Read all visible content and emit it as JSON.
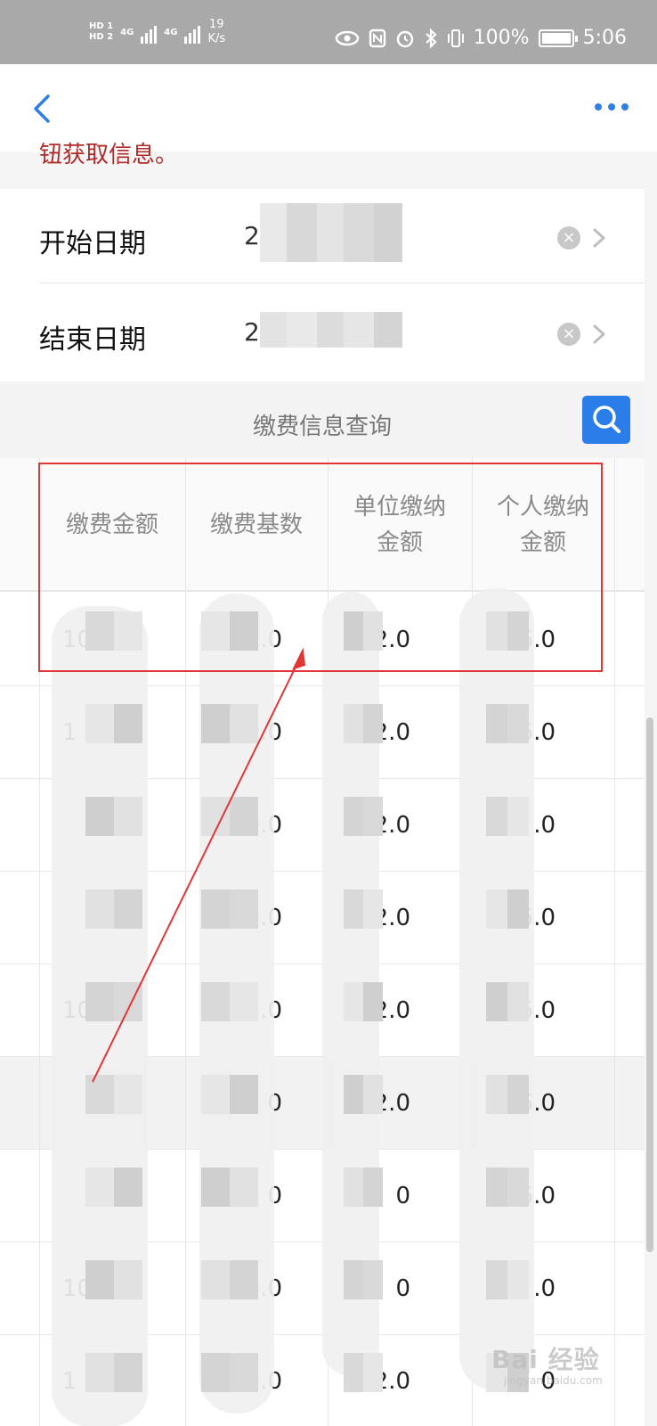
{
  "status_bar": {
    "hd1": "HD 1",
    "hd2": "HD 2",
    "net1": "4G",
    "net2": "4G",
    "speed_value": "19",
    "speed_unit": "K/s",
    "battery": "100%",
    "time": "5:06",
    "icons": [
      "eye-icon",
      "nfc-icon",
      "alarm-icon",
      "bluetooth-icon",
      "vibrate-icon",
      "battery-icon"
    ]
  },
  "nav": {
    "back_icon": "chevron-left-icon",
    "more_icon": "more-dots-icon",
    "accent": "#2f7ee6"
  },
  "hint": {
    "text": "钮获取信息。",
    "color": "#b02a2a"
  },
  "form": {
    "start_label": "开始日期",
    "start_value": "2",
    "end_label": "结束日期",
    "end_value": "2"
  },
  "query": {
    "title": "缴费信息查询",
    "search_icon": "search-icon",
    "button_color": "#2b7de9"
  },
  "table": {
    "headers": [
      "缴费金额",
      "缴费基数",
      "单位缴纳\n金额",
      "个人缴纳\n金额"
    ],
    "rows": [
      [
        "10",
        ".0",
        "72.0",
        "36.0"
      ],
      [
        "1",
        "0.0",
        "2.0",
        "6.0"
      ],
      [
        "",
        "0.0",
        "2.0",
        ".0"
      ],
      [
        "",
        "0.0",
        "72.0",
        "6.0"
      ],
      [
        "10",
        ".0",
        "72.0",
        "6.0"
      ],
      [
        "",
        "4 0",
        "2.0",
        "36.0"
      ],
      [
        "",
        "4 0",
        "0",
        "6.0"
      ],
      [
        "10",
        "0.0",
        "0",
        ".0"
      ],
      [
        "1",
        "0.0",
        "672.0",
        "0"
      ]
    ]
  },
  "annotation": {
    "color": "#e23636"
  },
  "watermark": {
    "text": "Bai 经验",
    "sub": "jingyan.baidu.com"
  }
}
